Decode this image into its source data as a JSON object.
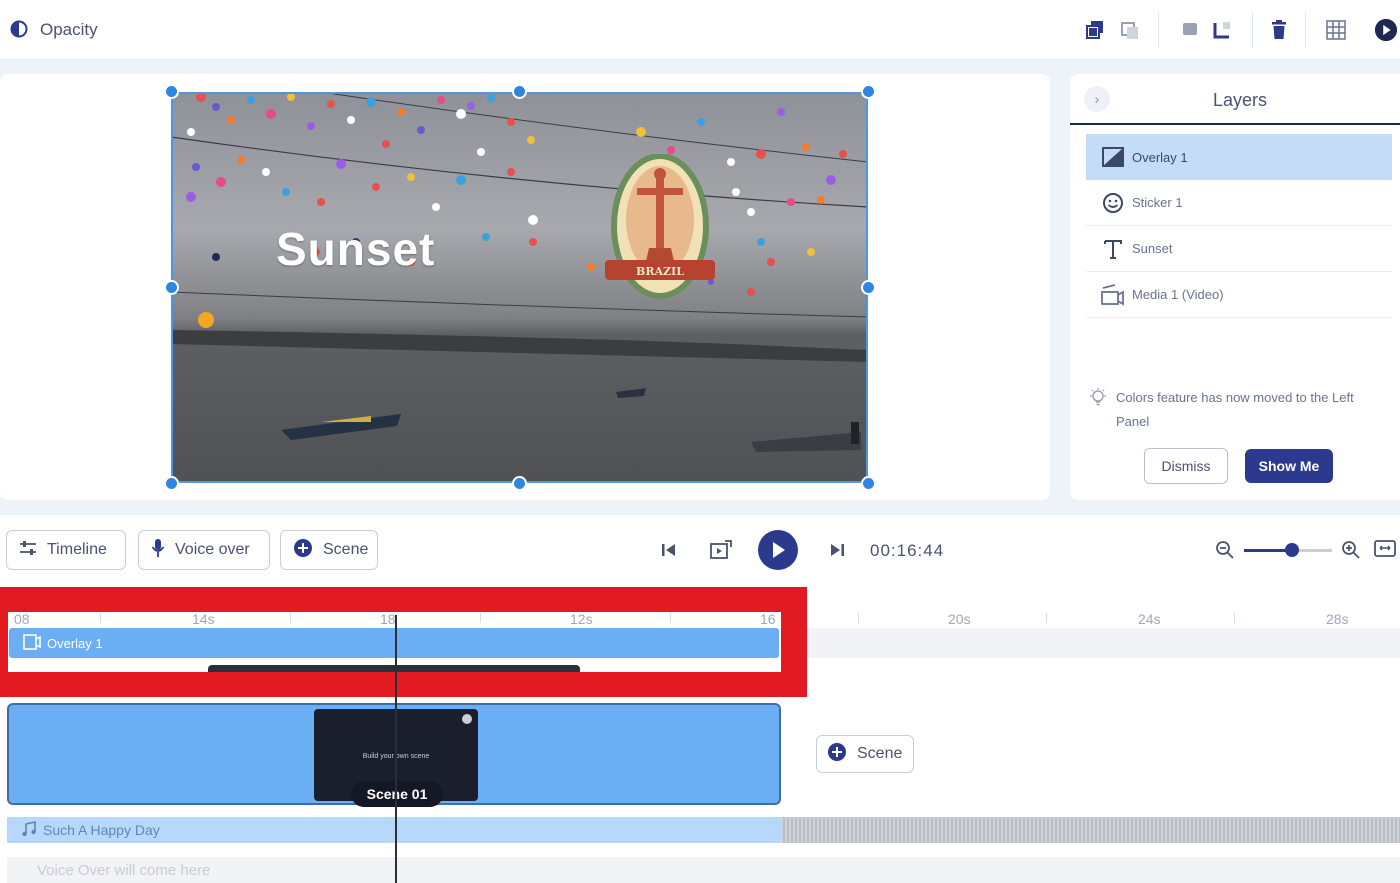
{
  "toolbar": {
    "opacity_label": "Opacity"
  },
  "canvas": {
    "title_text": "Sunset",
    "sticker_text": "BRAZIL"
  },
  "layers": {
    "title": "Layers",
    "items": [
      {
        "label": "Overlay 1",
        "icon": "overlay-icon",
        "active": true
      },
      {
        "label": "Sticker 1",
        "icon": "smiley-icon",
        "active": false
      },
      {
        "label": "Sunset",
        "icon": "text-icon",
        "active": false
      },
      {
        "label": "Media 1 (Video)",
        "icon": "video-icon",
        "active": false
      }
    ],
    "tip_text": "Colors feature has now moved to the Left Panel",
    "dismiss_label": "Dismiss",
    "show_me_label": "Show Me"
  },
  "controls": {
    "timeline_label": "Timeline",
    "voice_over_label": "Voice over",
    "scene_label": "Scene",
    "time": "00:16:44",
    "zoom_level": 0.55
  },
  "timeline": {
    "ruler": [
      "08",
      "14s",
      "18",
      "12s",
      "16",
      "20s",
      "24s",
      "28s"
    ],
    "overlay_label": "Overlay 1",
    "scene_thumb_text": "Build your own scene",
    "scene_name": "Scene 01",
    "add_scene_label": "Scene",
    "audio_label": "Such A Happy Day",
    "voice_placeholder": "Voice Over will come here"
  },
  "colors": {
    "accent": "#2b3a8c",
    "selection": "#2f86e0",
    "track": "#6caef3",
    "highlight_frame": "#e21b23"
  }
}
